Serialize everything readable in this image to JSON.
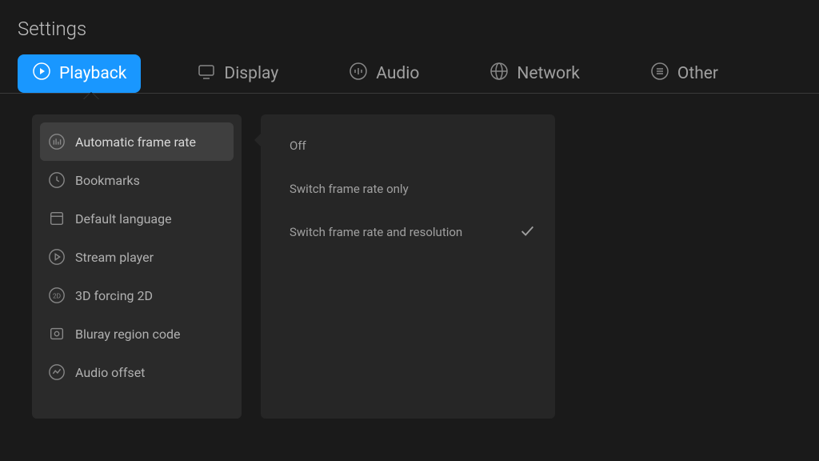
{
  "title": "Settings",
  "tabs": {
    "playback": "Playback",
    "display": "Display",
    "audio": "Audio",
    "network": "Network",
    "other": "Other"
  },
  "sidebar": {
    "items": [
      {
        "label": "Automatic frame rate"
      },
      {
        "label": "Bookmarks"
      },
      {
        "label": "Default language"
      },
      {
        "label": "Stream player"
      },
      {
        "label": "3D forcing 2D"
      },
      {
        "label": "Bluray region code"
      },
      {
        "label": "Audio offset"
      }
    ]
  },
  "panel": {
    "options": [
      {
        "label": "Off",
        "selected": false
      },
      {
        "label": "Switch frame rate only",
        "selected": false
      },
      {
        "label": "Switch frame rate and resolution",
        "selected": true
      }
    ]
  }
}
